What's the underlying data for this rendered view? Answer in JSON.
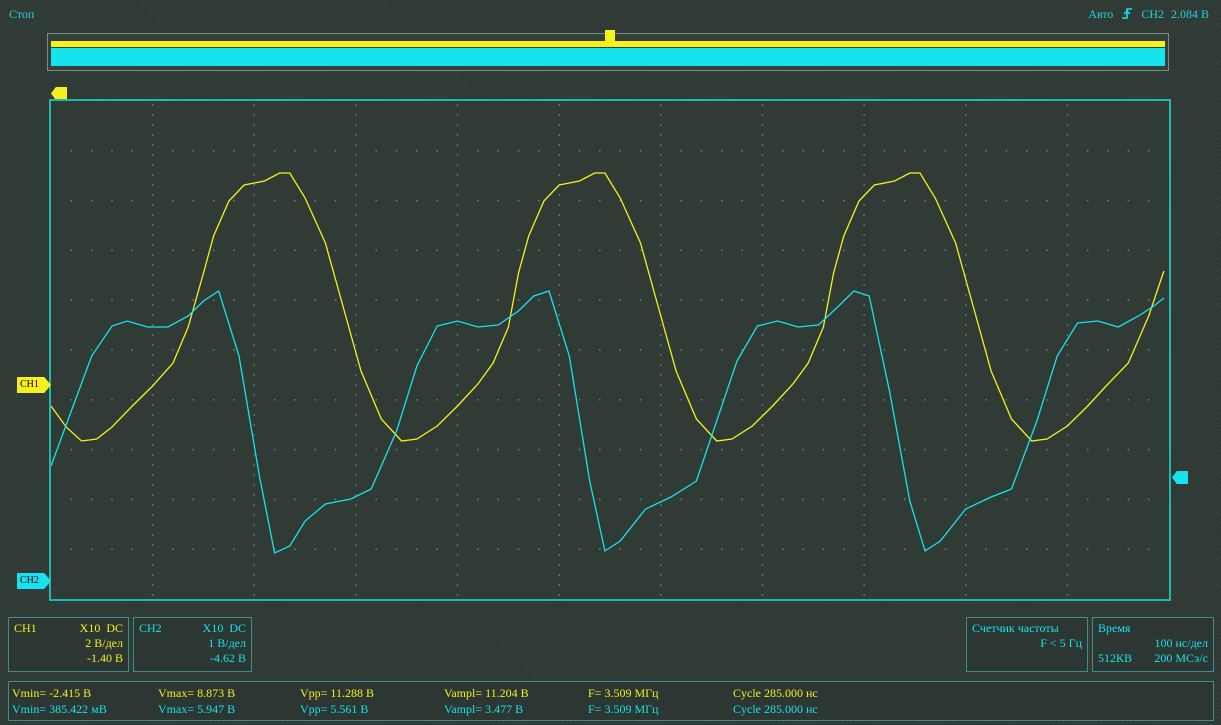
{
  "header": {
    "status": "Стоп",
    "trigger_mode": "Авто",
    "trigger_source": "CH2",
    "trigger_level": "2.084 В"
  },
  "markers": {
    "ch1": "CH1",
    "ch2": "CH2"
  },
  "channels": [
    {
      "name": "CH1",
      "probe": "X10",
      "coupling": "DC",
      "scale": "2 В/дел",
      "offset": "-1.40 В",
      "color": "#f6f01c"
    },
    {
      "name": "CH2",
      "probe": "X10",
      "coupling": "DC",
      "scale": "1 В/дел",
      "offset": "-4.62 В",
      "color": "#18e2ee"
    }
  ],
  "freq_counter": {
    "title": "Счетчик частоты",
    "value": "F < 5 Гц"
  },
  "timebase": {
    "title": "Время",
    "scale": "100 нс/дел",
    "memory": "512КВ",
    "rate": "200 МСэ/с"
  },
  "measurements": [
    {
      "vmin": "Vmin= -2.415 В",
      "vmax": "Vmax= 8.873 В",
      "vpp": "Vpp= 11.288 В",
      "vampl": "Vampl= 11.204 В",
      "freq": "F= 3.509 МГц",
      "cycle": "Cycle 285.000 нс"
    },
    {
      "vmin": "Vmin= 385.422 мВ",
      "vmax": "Vmax= 5.947 В",
      "vpp": "Vpp= 5.561 В",
      "vampl": "Vampl= 3.477 В",
      "freq": "F= 3.509 МГц",
      "cycle": "Cycle 285.000 нс"
    }
  ],
  "colors": {
    "ch1": "#f6f01c",
    "ch2": "#18e2ee",
    "grid_border": "#1fb9b4",
    "grid_dots": "#4f8f88"
  },
  "icons": [
    "trigger-edge-icon",
    "trigger-position-icon",
    "ch1-offset-marker-icon",
    "ch2-offset-marker-icon",
    "trigger-level-marker-icon"
  ],
  "waveforms": {
    "ch1": [
      [
        0,
        305
      ],
      [
        0.15,
        326
      ],
      [
        0.3,
        340
      ],
      [
        0.45,
        338
      ],
      [
        0.6,
        326
      ],
      [
        0.8,
        305
      ],
      [
        1.0,
        285
      ],
      [
        1.2,
        262
      ],
      [
        1.35,
        226
      ],
      [
        1.5,
        172
      ],
      [
        1.6,
        135
      ],
      [
        1.75,
        100
      ],
      [
        1.9,
        84
      ],
      [
        2.1,
        80
      ],
      [
        2.25,
        72
      ],
      [
        2.35,
        72
      ],
      [
        2.5,
        97
      ],
      [
        2.7,
        142
      ],
      [
        2.9,
        215
      ],
      [
        3.05,
        270
      ],
      [
        3.25,
        318
      ],
      [
        3.45,
        340
      ],
      [
        3.6,
        338
      ],
      [
        3.8,
        325
      ],
      [
        4.0,
        305
      ],
      [
        4.2,
        283
      ],
      [
        4.35,
        262
      ],
      [
        4.5,
        226
      ],
      [
        4.6,
        172
      ],
      [
        4.7,
        135
      ],
      [
        4.85,
        100
      ],
      [
        5.0,
        84
      ],
      [
        5.2,
        80
      ],
      [
        5.35,
        72
      ],
      [
        5.45,
        72
      ],
      [
        5.6,
        97
      ],
      [
        5.8,
        142
      ],
      [
        6.0,
        215
      ],
      [
        6.15,
        270
      ],
      [
        6.35,
        318
      ],
      [
        6.55,
        340
      ],
      [
        6.7,
        338
      ],
      [
        6.9,
        325
      ],
      [
        7.1,
        305
      ],
      [
        7.3,
        283
      ],
      [
        7.45,
        262
      ],
      [
        7.6,
        226
      ],
      [
        7.7,
        172
      ],
      [
        7.8,
        135
      ],
      [
        7.95,
        100
      ],
      [
        8.1,
        84
      ],
      [
        8.3,
        80
      ],
      [
        8.45,
        72
      ],
      [
        8.55,
        72
      ],
      [
        8.7,
        97
      ],
      [
        8.9,
        142
      ],
      [
        9.1,
        215
      ],
      [
        9.25,
        270
      ],
      [
        9.45,
        318
      ],
      [
        9.65,
        340
      ],
      [
        9.8,
        338
      ],
      [
        10.0,
        325
      ],
      [
        10.2,
        305
      ],
      [
        10.4,
        283
      ],
      [
        10.6,
        262
      ],
      [
        10.8,
        215
      ],
      [
        10.95,
        170
      ]
    ],
    "ch2": [
      [
        0,
        365
      ],
      [
        0.2,
        310
      ],
      [
        0.4,
        255
      ],
      [
        0.6,
        225
      ],
      [
        0.75,
        220
      ],
      [
        0.95,
        226
      ],
      [
        1.15,
        226
      ],
      [
        1.35,
        215
      ],
      [
        1.5,
        200
      ],
      [
        1.65,
        190
      ],
      [
        1.85,
        255
      ],
      [
        2.05,
        375
      ],
      [
        2.2,
        452
      ],
      [
        2.35,
        445
      ],
      [
        2.5,
        420
      ],
      [
        2.7,
        403
      ],
      [
        2.95,
        398
      ],
      [
        3.15,
        388
      ],
      [
        3.4,
        330
      ],
      [
        3.6,
        265
      ],
      [
        3.8,
        225
      ],
      [
        4.0,
        220
      ],
      [
        4.2,
        226
      ],
      [
        4.4,
        224
      ],
      [
        4.6,
        210
      ],
      [
        4.75,
        195
      ],
      [
        4.9,
        190
      ],
      [
        5.1,
        255
      ],
      [
        5.3,
        380
      ],
      [
        5.45,
        450
      ],
      [
        5.6,
        440
      ],
      [
        5.85,
        408
      ],
      [
        6.1,
        396
      ],
      [
        6.35,
        380
      ],
      [
        6.55,
        320
      ],
      [
        6.75,
        260
      ],
      [
        6.95,
        225
      ],
      [
        7.15,
        220
      ],
      [
        7.35,
        226
      ],
      [
        7.55,
        224
      ],
      [
        7.75,
        205
      ],
      [
        7.9,
        190
      ],
      [
        8.05,
        195
      ],
      [
        8.25,
        290
      ],
      [
        8.45,
        400
      ],
      [
        8.6,
        450
      ],
      [
        8.75,
        440
      ],
      [
        9.0,
        408
      ],
      [
        9.25,
        396
      ],
      [
        9.45,
        388
      ],
      [
        9.7,
        320
      ],
      [
        9.9,
        255
      ],
      [
        10.1,
        222
      ],
      [
        10.3,
        220
      ],
      [
        10.5,
        226
      ],
      [
        10.7,
        215
      ],
      [
        10.85,
        205
      ],
      [
        10.95,
        197
      ]
    ]
  }
}
